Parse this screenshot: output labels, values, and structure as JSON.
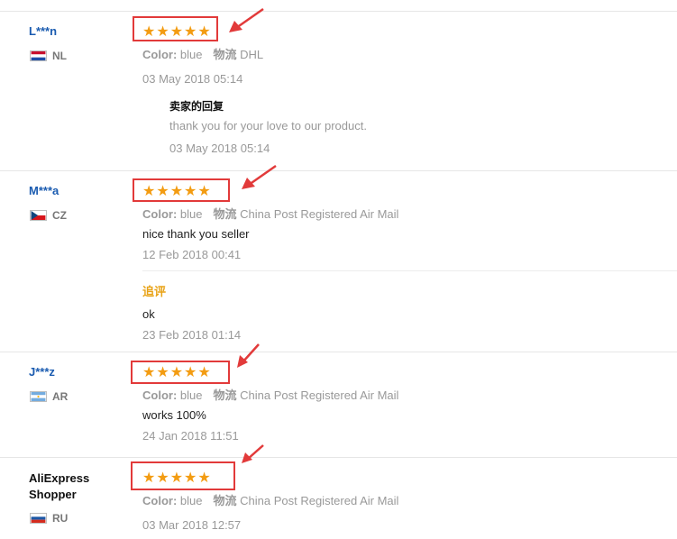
{
  "colors": {
    "accent_star": "#f39c12",
    "annotation_red": "#e23a3a",
    "name_blue": "#1a5bb0",
    "followup_orange": "#e8a317"
  },
  "reviews": [
    {
      "user": "L***n",
      "country": "NL",
      "flag": "netherlands-flag-icon",
      "rating": 5,
      "color_label": "Color:",
      "color_value": "blue",
      "shipping_label": "物流",
      "shipping_value": "DHL",
      "date": "03 May 2018 05:14",
      "seller_reply": {
        "title": "卖家的回复",
        "text": "thank you for your love to our product.",
        "date": "03 May 2018 05:14"
      }
    },
    {
      "user": "M***a",
      "country": "CZ",
      "flag": "czech-flag-icon",
      "rating": 5,
      "color_label": "Color:",
      "color_value": "blue",
      "shipping_label": "物流",
      "shipping_value": "China Post Registered Air Mail",
      "text": "nice thank you seller",
      "date": "12 Feb 2018 00:41",
      "followup": {
        "label": "追评",
        "text": "ok",
        "date": "23 Feb 2018 01:14"
      }
    },
    {
      "user": "J***z",
      "country": "AR",
      "flag": "argentina-flag-icon",
      "rating": 5,
      "color_label": "Color:",
      "color_value": "blue",
      "shipping_label": "物流",
      "shipping_value": "China Post Registered Air Mail",
      "text": "works 100%",
      "date": "24 Jan 2018 11:51"
    },
    {
      "user_line1": "AliExpress",
      "user_line2": "Shopper",
      "country": "RU",
      "flag": "russia-flag-icon",
      "rating": 5,
      "color_label": "Color:",
      "color_value": "blue",
      "shipping_label": "物流",
      "shipping_value": "China Post Registered Air Mail",
      "date": "03 Mar 2018 12:57"
    }
  ]
}
